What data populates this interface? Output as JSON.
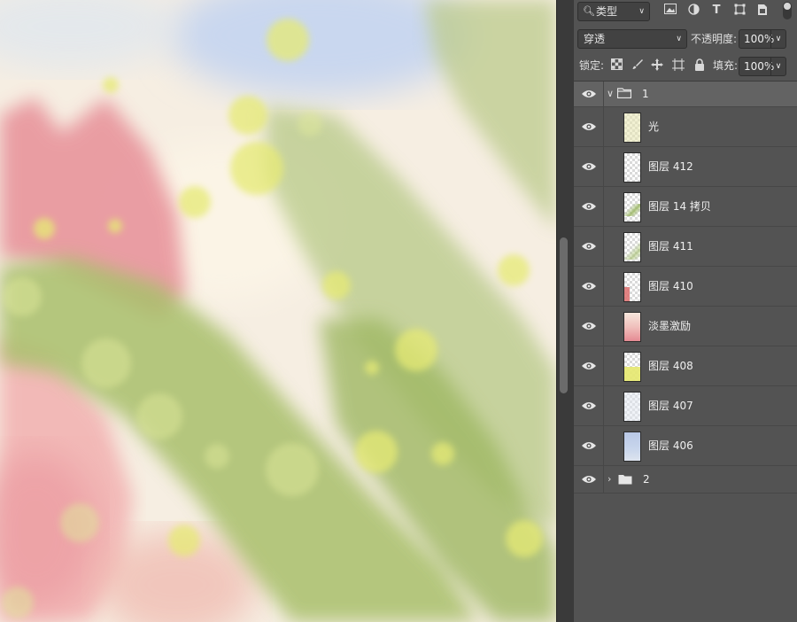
{
  "layers_panel": {
    "filter": {
      "label": "类型",
      "icon": "search-icon"
    },
    "filter_icons": [
      "image-filter-icon",
      "adjustment-filter-icon",
      "text-filter-icon",
      "shape-filter-icon",
      "smart-object-filter-icon"
    ],
    "blend_mode": "穿透",
    "opacity_label": "不透明度:",
    "opacity_value": "100%",
    "lock_label": "锁定:",
    "lock_icons": [
      "lock-transparent-icon",
      "lock-paint-icon",
      "lock-move-icon",
      "lock-artboard-icon",
      "lock-all-icon"
    ],
    "fill_label": "填充:",
    "fill_value": "100%",
    "group_open": {
      "name": "1"
    },
    "layers": [
      {
        "name": "光"
      },
      {
        "name": "图层 412"
      },
      {
        "name": "图层 14 拷贝"
      },
      {
        "name": "图层 411"
      },
      {
        "name": "图层 410"
      },
      {
        "name": "淡墨激励"
      },
      {
        "name": "图层 408"
      },
      {
        "name": "图层 407"
      },
      {
        "name": "图层 406"
      }
    ],
    "group_closed": {
      "name": "2"
    }
  },
  "colors": {
    "panel_bg": "#535353",
    "selected_row": "#636363",
    "canvas_pink": "#e58a93",
    "canvas_green": "#a8bf6a",
    "canvas_yellow": "#e8ec7a",
    "canvas_blue": "#c9d8ef"
  }
}
